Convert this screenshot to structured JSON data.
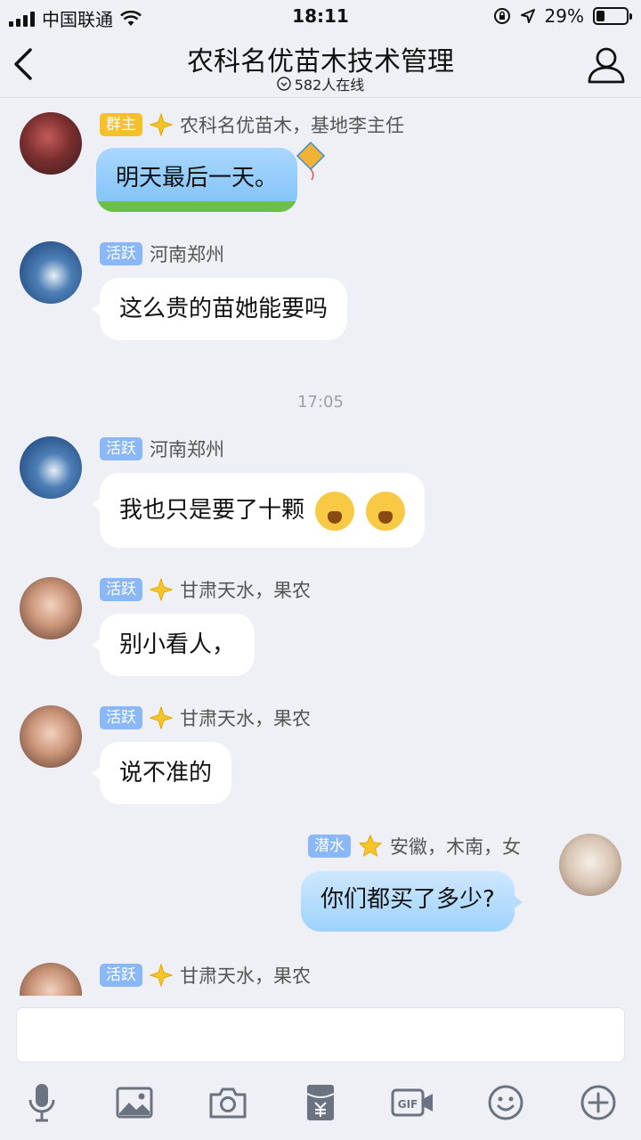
{
  "status_bar": {
    "carrier": "中国联通",
    "time": "18:11",
    "battery": "29%",
    "battery_level": 0.29
  },
  "header": {
    "title": "农科名优苗木技术管理",
    "online": "582人在线"
  },
  "messages": [
    {
      "badge": "群主",
      "name": "农科名优苗木，基地李主任",
      "text": "明天最后一天。"
    },
    {
      "badge": "活跃",
      "name": "河南郑州",
      "text": "这么贵的苗她能要吗"
    },
    {
      "badge": "活跃",
      "name": "河南郑州",
      "text": "我也只是要了十颗"
    },
    {
      "badge": "活跃",
      "name": "甘肃天水，果农",
      "text": "别小看人，"
    },
    {
      "badge": "活跃",
      "name": "甘肃天水，果农",
      "text": "说不准的"
    },
    {
      "badge": "潜水",
      "name": "安徽，木南，女",
      "text": "你们都买了多少?"
    },
    {
      "badge": "活跃",
      "name": "甘肃天水，果农",
      "text": ""
    }
  ],
  "time_divider": "17:05",
  "colors": {
    "background": "#eef0f5",
    "badge_owner": "#f5c02b",
    "badge_active": "#8ab7f5",
    "bubble": "#ffffff",
    "icon": "#6b7280"
  },
  "toolbar": {
    "icons": [
      "microphone-icon",
      "image-icon",
      "camera-icon",
      "red-packet-icon",
      "gif-icon",
      "emoji-icon",
      "plus-icon"
    ]
  }
}
